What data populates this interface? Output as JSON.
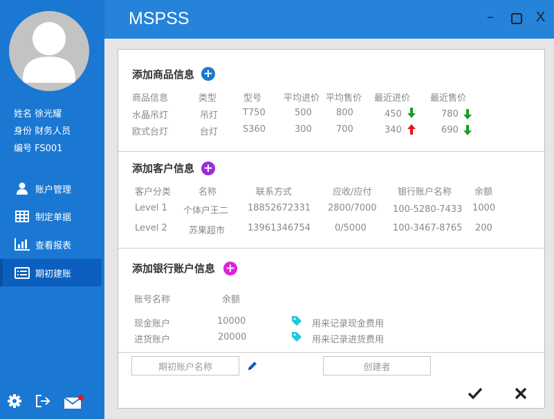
{
  "app": {
    "title": "MSPSS"
  },
  "window": {
    "minimize": "–",
    "close": "X"
  },
  "user": {
    "name_label": "姓名 徐光耀",
    "role_label": "身份 财务人员",
    "id_label": "编号 FS001"
  },
  "nav": {
    "items": [
      {
        "label": "账户管理",
        "icon": "user-icon"
      },
      {
        "label": "制定单据",
        "icon": "table-icon"
      },
      {
        "label": "查看报表",
        "icon": "bar-chart-icon"
      },
      {
        "label": "期初建账",
        "icon": "list-icon",
        "active": true
      }
    ]
  },
  "bottom_icons": [
    "gear-icon",
    "logout-icon",
    "mail-icon"
  ],
  "goods": {
    "title": "添加商品信息",
    "headers": [
      "商品信息",
      "类型",
      "型号",
      "平均进价",
      "平均售价",
      "最近进价",
      "最近售价"
    ],
    "rows": [
      {
        "name": "水晶吊灯",
        "type": "吊灯",
        "model": "T750",
        "avg_in": "500",
        "avg_out": "800",
        "last_in": "450",
        "last_in_trend": "down",
        "last_out": "780",
        "last_out_trend": "down"
      },
      {
        "name": "欧式台灯",
        "type": "台灯",
        "model": "S360",
        "avg_in": "300",
        "avg_out": "700",
        "last_in": "340",
        "last_in_trend": "up",
        "last_out": "690",
        "last_out_trend": "down"
      }
    ]
  },
  "customers": {
    "title": "添加客户信息",
    "headers": [
      "客户分类",
      "名称",
      "联系方式",
      "应收/应付",
      "银行账户名称",
      "余额"
    ],
    "rows": [
      {
        "level": "Level 1",
        "name": "个体户王二",
        "phone": "18852672331",
        "ar_ap": "2800/7000",
        "bank": "100-5280-7433",
        "balance": "1000"
      },
      {
        "level": "Level 2",
        "name": "苏果超市",
        "phone": "13961346754",
        "ar_ap": "0/5000",
        "bank": "100-3467-8765",
        "balance": "200"
      }
    ]
  },
  "bank": {
    "title": "添加银行账户信息",
    "headers": [
      "账号名称",
      "余额"
    ],
    "rows": [
      {
        "name": "现金账户",
        "amount": "10000",
        "note": "用来记录现金费用"
      },
      {
        "name": "进货账户",
        "amount": "20000",
        "note": "用来记录进货费用"
      }
    ]
  },
  "footer": {
    "account_name_placeholder": "期初账户名称",
    "creator_placeholder": "创建者"
  },
  "colors": {
    "sidebar": "#1a78d2",
    "titlebar": "#2583da",
    "add_goods": "#1a78d2",
    "add_customer": "#9b2bd8",
    "add_bank": "#e020d8",
    "arrow_down": "#17a01f",
    "arrow_up": "#e8121e",
    "tag": "#1ec7d9"
  }
}
